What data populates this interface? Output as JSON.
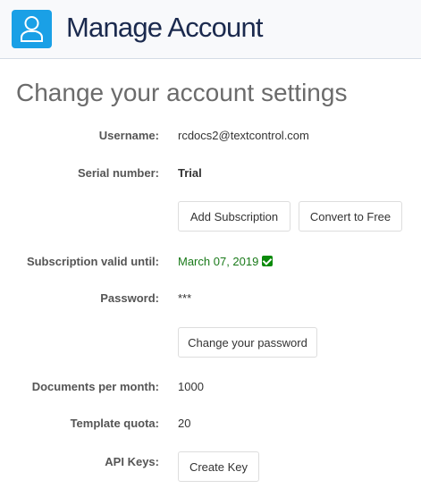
{
  "header": {
    "title": "Manage Account",
    "icon": "user-icon",
    "icon_color": "#1aa0e6"
  },
  "page": {
    "heading": "Change your account settings"
  },
  "fields": {
    "username": {
      "label": "Username:",
      "value": "rcdocs2@textcontrol.com"
    },
    "serial": {
      "label": "Serial number:",
      "value": "Trial"
    },
    "subscription": {
      "label": "Subscription valid until:",
      "value": "March 07, 2019"
    },
    "password": {
      "label": "Password:",
      "value": "***"
    },
    "documents": {
      "label": "Documents per month:",
      "value": "1000"
    },
    "template": {
      "label": "Template quota:",
      "value": "20"
    },
    "api": {
      "label": "API Keys:"
    }
  },
  "buttons": {
    "add_subscription": "Add Subscription",
    "convert_free": "Convert to Free",
    "change_password": "Change your password",
    "create_key": "Create Key"
  }
}
